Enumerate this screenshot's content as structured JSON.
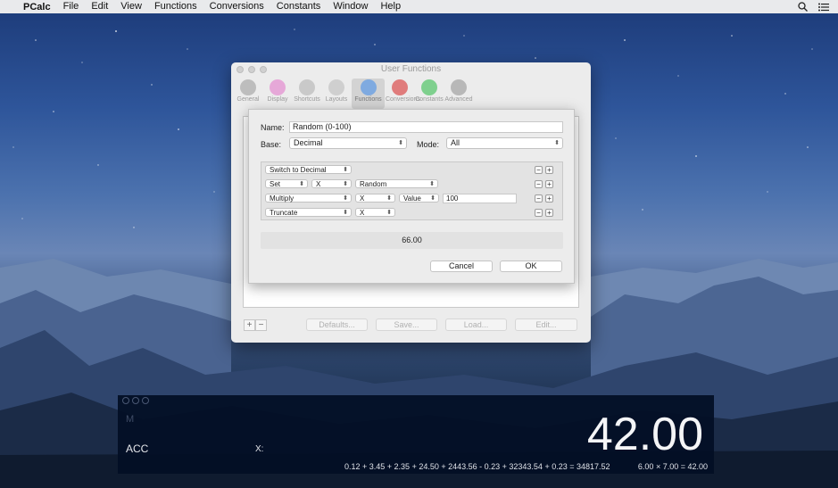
{
  "menubar": {
    "app_name": "PCalc",
    "items": [
      "File",
      "Edit",
      "View",
      "Functions",
      "Conversions",
      "Constants",
      "Window",
      "Help"
    ]
  },
  "prefs_window": {
    "title": "User Functions",
    "toolbar": [
      {
        "label": "General",
        "icon": "general-icon",
        "color": "#bdbdbd"
      },
      {
        "label": "Display",
        "icon": "display-icon",
        "color": "#e6a8d8"
      },
      {
        "label": "Shortcuts",
        "icon": "keyboard-icon",
        "color": "#c9c9c9"
      },
      {
        "label": "Layouts",
        "icon": "layouts-icon",
        "color": "#cfcfcf"
      },
      {
        "label": "Functions",
        "icon": "functions-icon",
        "color": "#7faae0"
      },
      {
        "label": "Conversions",
        "icon": "conversions-icon",
        "color": "#e07c7c"
      },
      {
        "label": "Constants",
        "icon": "constants-icon",
        "color": "#7fd08e"
      },
      {
        "label": "Advanced",
        "icon": "gear-icon",
        "color": "#b8b8b8"
      }
    ],
    "toolbar_selected": "Functions",
    "add_label": "+",
    "remove_label": "−",
    "buttons": {
      "defaults": "Defaults...",
      "save": "Save...",
      "load": "Load...",
      "edit": "Edit..."
    }
  },
  "sheet": {
    "name_label": "Name:",
    "name_value": "Random (0-100)",
    "base_label": "Base:",
    "base_value": "Decimal",
    "mode_label": "Mode:",
    "mode_value": "All",
    "actions": [
      {
        "cells": [
          "Switch to Decimal"
        ]
      },
      {
        "cells": [
          "Set",
          "X",
          "Random"
        ]
      },
      {
        "cells": [
          "Multiply",
          "X",
          "Value"
        ],
        "field": "100"
      },
      {
        "cells": [
          "Truncate",
          "X"
        ]
      }
    ],
    "minus_label": "−",
    "plus_label": "+",
    "result": "66.00",
    "cancel_label": "Cancel",
    "ok_label": "OK"
  },
  "pcalc": {
    "memory_label": "M",
    "acc_label": "ACC",
    "x_label": "X:",
    "display_value": "42.00",
    "paper_tape": "0.12 + 3.45 + 2.35 + 24.50 + 2443.56 - 0.23 + 32343.54 + 0.23 = 34817.52",
    "last_calc": "6.00 × 7.00 = 42.00"
  }
}
